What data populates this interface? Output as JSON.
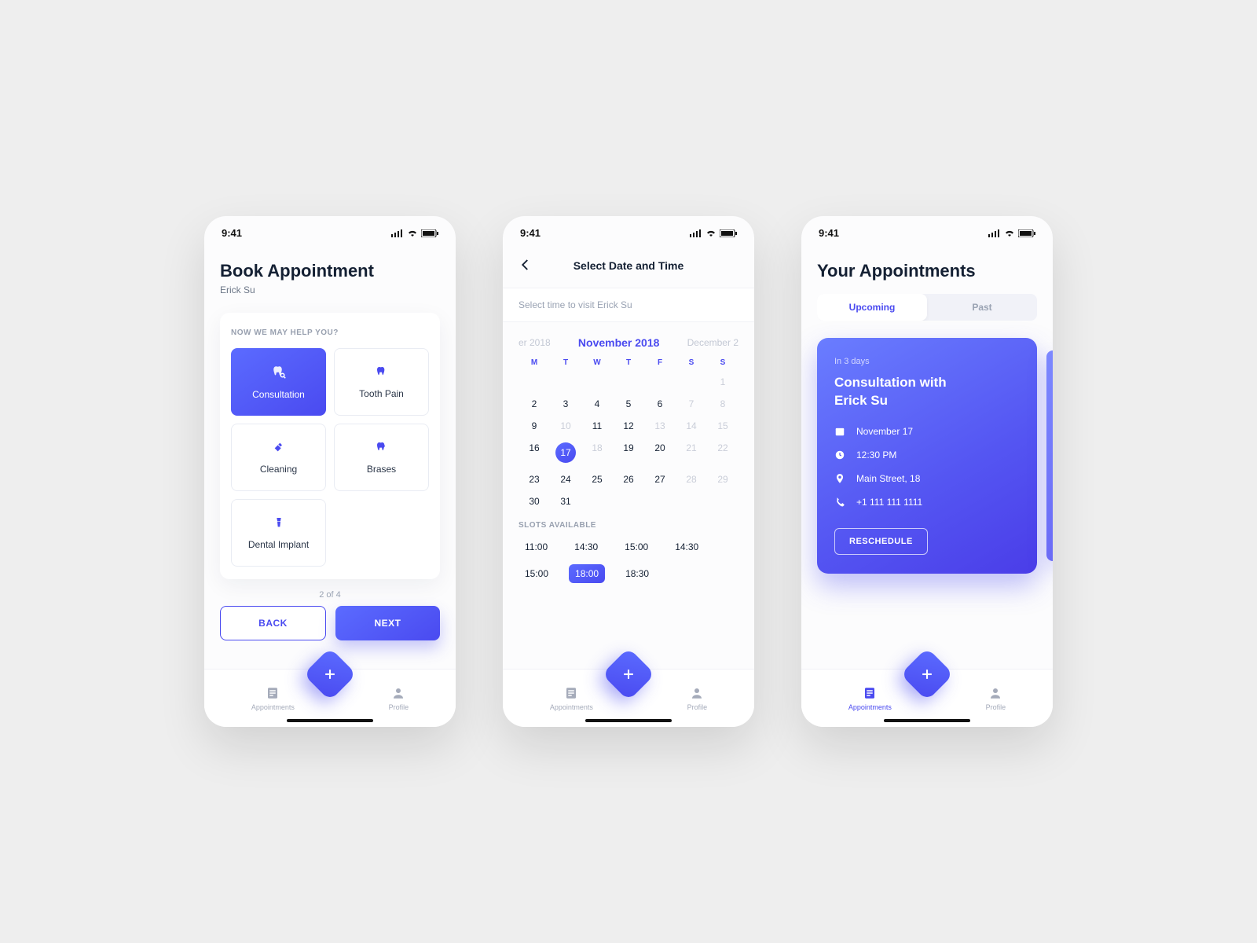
{
  "status": {
    "time": "9:41"
  },
  "nav": {
    "appointments": "Appointments",
    "profile": "Profile"
  },
  "screen1": {
    "title": "Book Appointment",
    "subtitle": "Erick Su",
    "card_label": "NOW WE MAY HELP YOU?",
    "services": {
      "s0": "Consultation",
      "s1": "Tooth Pain",
      "s2": "Cleaning",
      "s3": "Brases",
      "s4": "Dental Implant"
    },
    "pager": "2 of 4",
    "back": "BACK",
    "next": "NEXT"
  },
  "screen2": {
    "header": "Select Date and Time",
    "hint": "Select time to visit Erick Su",
    "month_prev": "er 2018",
    "month_current": "November 2018",
    "month_next": "December 2",
    "dow": {
      "d0": "M",
      "d1": "T",
      "d2": "W",
      "d3": "T",
      "d4": "F",
      "d5": "S",
      "d6": "S"
    },
    "days": {
      "r0": [
        "",
        "",
        "",
        "",
        "",
        "",
        "1"
      ],
      "r1": [
        "2",
        "3",
        "4",
        "5",
        "6",
        "7",
        "8"
      ],
      "r2": [
        "9",
        "10",
        "11",
        "12",
        "13",
        "14",
        "15"
      ],
      "r3": [
        "16",
        "17",
        "18",
        "19",
        "20",
        "21",
        "22"
      ],
      "r4": [
        "23",
        "24",
        "25",
        "26",
        "27",
        "28",
        "29"
      ],
      "r5": [
        "30",
        "31",
        "",
        "",
        "",
        "",
        ""
      ]
    },
    "slots_label": "SLOTS AVAILABLE",
    "slots": {
      "t0": "11:00",
      "t1": "14:30",
      "t2": "15:00",
      "t3": "14:30",
      "t4": "15:00",
      "t5": "18:00",
      "t6": "18:30"
    }
  },
  "screen3": {
    "title": "Your Appointments",
    "tabs": {
      "upcoming": "Upcoming",
      "past": "Past"
    },
    "card": {
      "when": "In 3 days",
      "title": "Consultation with Erick Su",
      "date": "November 17",
      "time": "12:30 PM",
      "location": "Main Street, 18",
      "phone": "+1 111 111 1111",
      "reschedule": "RESCHEDULE"
    }
  }
}
